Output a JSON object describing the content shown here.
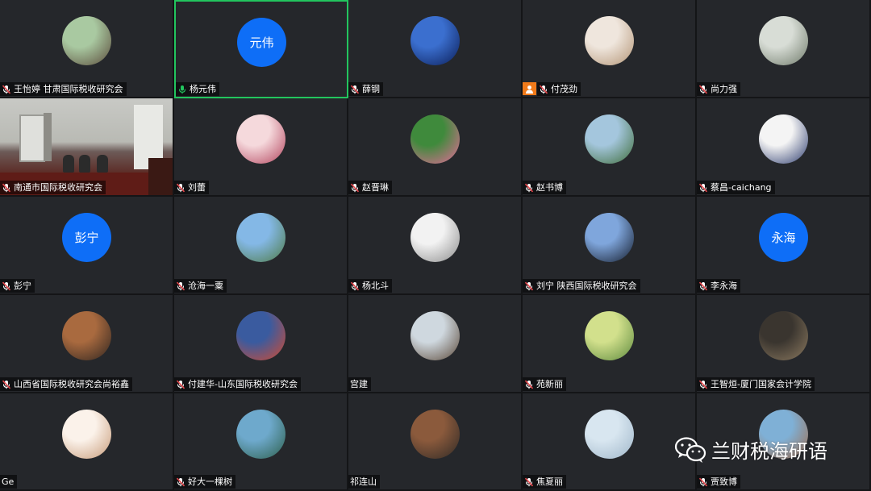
{
  "participants": [
    {
      "name": "王怡婷 甘肃国际税收研究会",
      "kind": "photo",
      "c1": "#a9c9a1",
      "c2": "#5b4b3b",
      "mic": "muted"
    },
    {
      "name": "杨元伟",
      "kind": "text",
      "initials": "元伟",
      "mic": "active",
      "active": true
    },
    {
      "name": "薛钢",
      "kind": "photo",
      "c1": "#3b6fcf",
      "c2": "#0b1e58",
      "mic": "muted"
    },
    {
      "name": "付茂劲",
      "kind": "photo",
      "c1": "#efe6dd",
      "c2": "#b39475",
      "mic": "muted",
      "orange": true
    },
    {
      "name": "尚力强",
      "kind": "photo",
      "c1": "#d8ddd6",
      "c2": "#6f7a6a",
      "mic": "muted"
    },
    {
      "name": "南通市国际税收研究会",
      "kind": "video",
      "mic": "muted"
    },
    {
      "name": "刘蕾",
      "kind": "photo",
      "c1": "#f5d9dc",
      "c2": "#b3435d",
      "mic": "muted"
    },
    {
      "name": "赵晋琳",
      "kind": "photo",
      "c1": "#3f8a3c",
      "c2": "#e86a9b",
      "mic": "muted"
    },
    {
      "name": "赵书博",
      "kind": "photo",
      "c1": "#a4c6dd",
      "c2": "#3f6d3a",
      "mic": "muted"
    },
    {
      "name": "蔡昌-caichang",
      "kind": "photo",
      "c1": "#f4f4f4",
      "c2": "#2c3b6e",
      "mic": "muted"
    },
    {
      "name": "彭宁",
      "kind": "text",
      "initials": "彭宁",
      "mic": "muted"
    },
    {
      "name": "沧海一粟",
      "kind": "photo",
      "c1": "#84b8e6",
      "c2": "#4e7a45",
      "mic": "muted"
    },
    {
      "name": "杨北斗",
      "kind": "photo",
      "c1": "#f2f2f2",
      "c2": "#8c8c8c",
      "mic": "muted"
    },
    {
      "name": "刘宁 陕西国际税收研究会",
      "kind": "photo",
      "c1": "#7fa6dc",
      "c2": "#141c2c",
      "mic": "muted"
    },
    {
      "name": "李永海",
      "kind": "text",
      "initials": "永海",
      "mic": "muted"
    },
    {
      "name": "山西省国际税收研究会尚裕鑫",
      "kind": "photo",
      "c1": "#a96a3f",
      "c2": "#2f2520",
      "mic": "muted"
    },
    {
      "name": "付建华-山东国际税收研究会",
      "kind": "photo",
      "c1": "#3a5b9f",
      "c2": "#d44b2f",
      "mic": "muted"
    },
    {
      "name": "宫建",
      "kind": "photo",
      "c1": "#cfd8df",
      "c2": "#5a4838",
      "mic": "none"
    },
    {
      "name": "苑新丽",
      "kind": "photo",
      "c1": "#d2e08c",
      "c2": "#5d8a3e",
      "mic": "muted"
    },
    {
      "name": "王智烜-厦门国家会计学院",
      "kind": "photo",
      "c1": "#3a352f",
      "c2": "#8c7a60",
      "mic": "muted"
    },
    {
      "name": "Ge",
      "kind": "photo",
      "c1": "#fbf2ea",
      "c2": "#c79a78",
      "mic": "none"
    },
    {
      "name": "好大一棵树",
      "kind": "photo",
      "c1": "#6ea9cc",
      "c2": "#2d5f4b",
      "mic": "muted"
    },
    {
      "name": "祁连山",
      "kind": "photo",
      "c1": "#8b5a3c",
      "c2": "#2f2a26",
      "mic": "none"
    },
    {
      "name": "焦夏丽",
      "kind": "photo",
      "c1": "#d8e6f0",
      "c2": "#9fb6c9",
      "mic": "muted"
    },
    {
      "name": "贾致博",
      "kind": "photo",
      "c1": "#7fb0d6",
      "c2": "#a06b4a",
      "mic": "muted"
    }
  ],
  "watermark": {
    "text": "兰财税海研语",
    "icon": "wechat-icon"
  },
  "colors": {
    "accent_active": "#22c55e",
    "avatar_blue": "#0e6ef7",
    "mic_muted": "#e5484d"
  }
}
